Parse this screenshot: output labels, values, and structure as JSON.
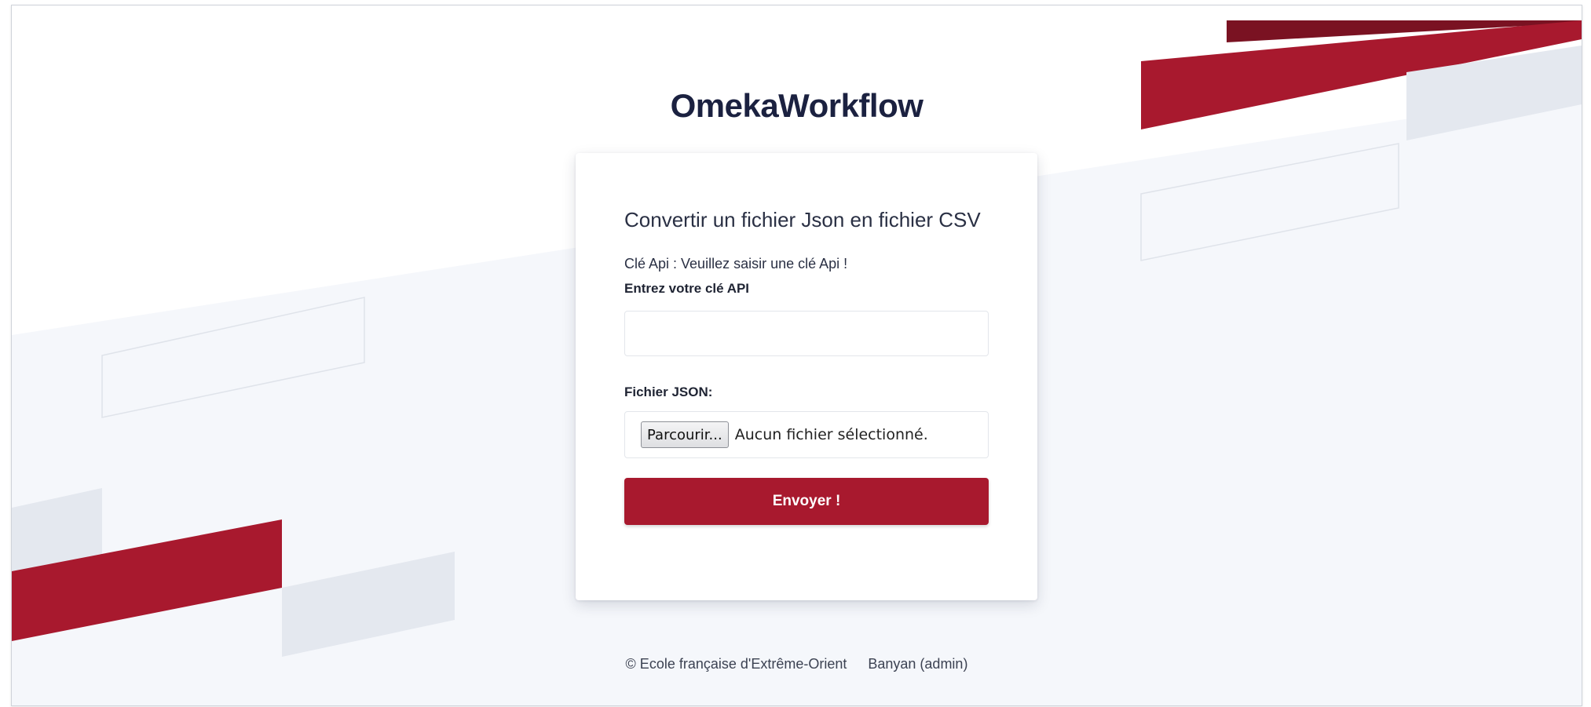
{
  "app": {
    "title": "OmekaWorkflow"
  },
  "form": {
    "title": "Convertir un fichier Json en fichier CSV",
    "api_status": "Clé Api : Veuillez saisir une clé Api !",
    "api_label": "Entrez votre clé API",
    "api_value": "",
    "json_label": "Fichier JSON:",
    "browse_label": "Parcourir...",
    "file_status": "Aucun fichier sélectionné.",
    "submit_label": "Envoyer !"
  },
  "footer": {
    "copyright": "© Ecole française d'Extrême-Orient",
    "user_link": "Banyan (admin)"
  },
  "colors": {
    "brand_red": "#a8192e",
    "dark_red": "#7a1222",
    "pale_gray": "#e4e8ef",
    "title_navy": "#1b2140"
  }
}
